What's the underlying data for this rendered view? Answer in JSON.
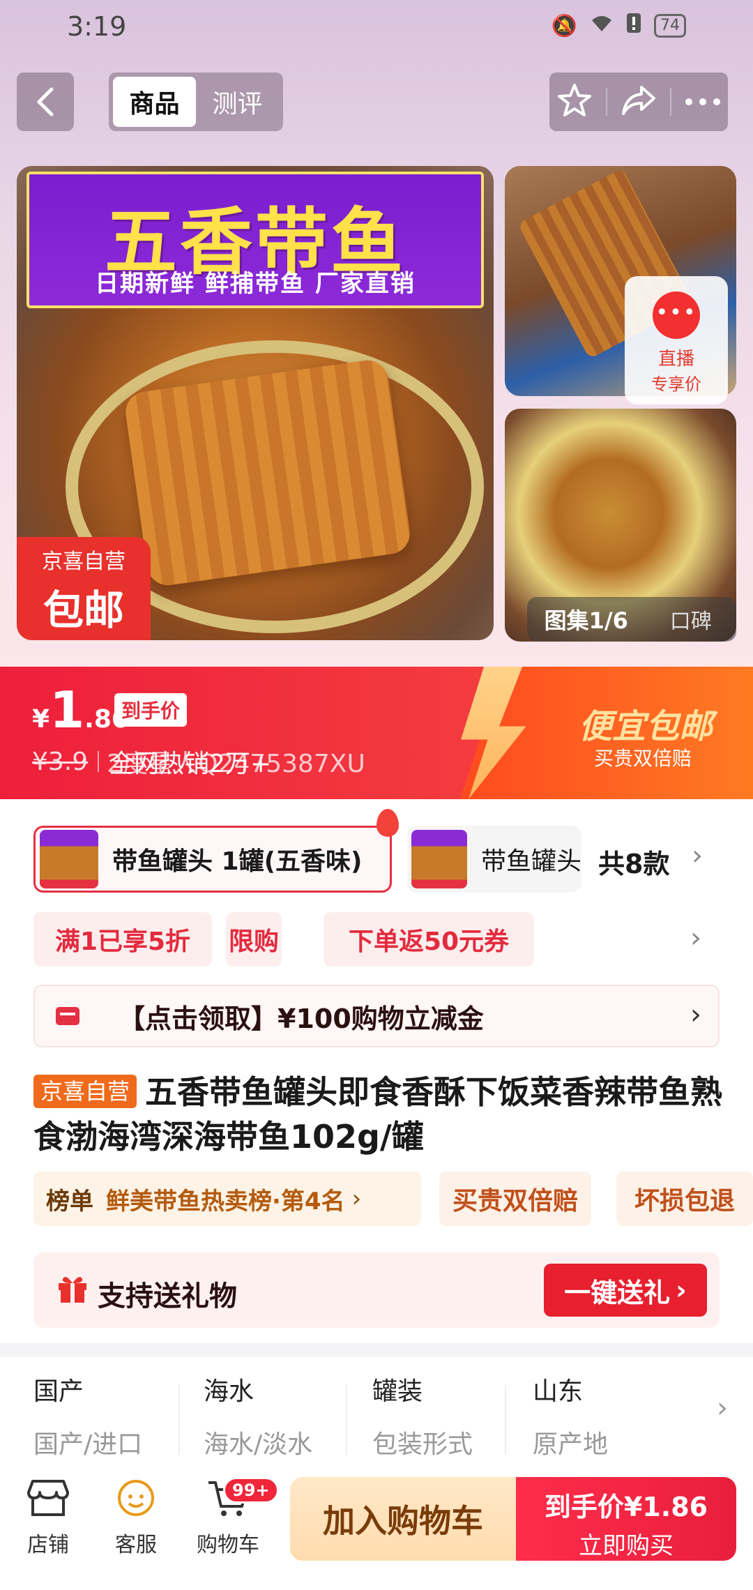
{
  "status": {
    "time": "3:19",
    "battery": "74"
  },
  "nav": {
    "tabs": [
      "商品",
      "测评"
    ],
    "active_tab": 0
  },
  "gallery": {
    "banner_title": "五香带鱼",
    "banner_sub": "日期新鲜   鲜捕带鱼   厂家直销",
    "badge_line1": "京喜自营",
    "badge_line2": "包邮",
    "live_line1": "直播",
    "live_line2": "专享价",
    "album_label": "图集1/6",
    "review_label": "口碑"
  },
  "price": {
    "currency": "¥",
    "integer": "1",
    "decimal": ".86",
    "tag": "到手价",
    "original": "¥3.9",
    "sales": "全网热销2万+",
    "overlay_text": "2度星人Q2475387XU",
    "promo_title": "便宜包邮",
    "promo_sub": "买贵双倍赔"
  },
  "variants": {
    "selected_label": "带鱼罐头 1罐(五香味)",
    "second_label": "带鱼罐头",
    "count": "共8款"
  },
  "promos": [
    "满1已享5折",
    "限购",
    "下单返50元券"
  ],
  "coupon": {
    "text": "【点击领取】¥100购物立减金"
  },
  "product": {
    "self_tag": "京喜自营",
    "title": "五香带鱼罐头即食香酥下饭菜香辣带鱼熟食渤海湾深海带鱼102g/罐"
  },
  "tags": {
    "rank_key": "榜单",
    "rank_value": "鲜美带鱼热卖榜·第4名",
    "guarantee1": "买贵双倍赔",
    "guarantee2": "坏损包退"
  },
  "gift": {
    "text": "支持送礼物",
    "button": "一键送礼"
  },
  "specs": [
    {
      "value": "国产",
      "key": "国产/进口"
    },
    {
      "value": "海水",
      "key": "海水/淡水"
    },
    {
      "value": "罐装",
      "key": "包装形式"
    },
    {
      "value": "山东",
      "key": "原产地"
    }
  ],
  "bottom": {
    "shop": "店铺",
    "service": "客服",
    "cart": "购物车",
    "cart_badge": "99+",
    "add_cart": "加入购物车",
    "buy_line1": "到手价¥1.86",
    "buy_line2": "立即购买"
  },
  "colors": {
    "accent": "#e81f2e",
    "promo_orange": "#f06a1c"
  }
}
